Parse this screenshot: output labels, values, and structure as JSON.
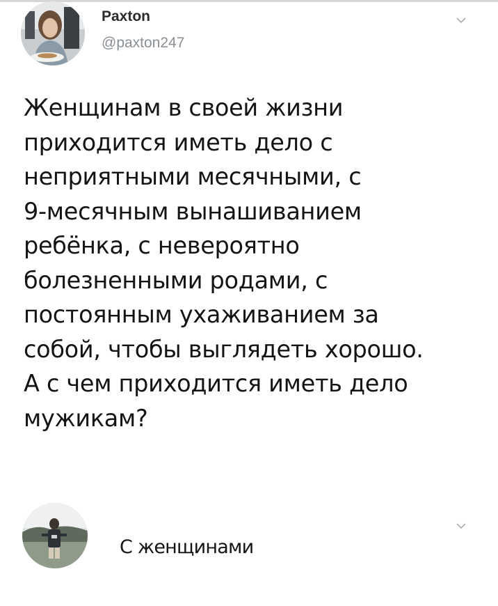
{
  "tweet_1": {
    "author_name": "Paxton",
    "author_handle": "@paxton247",
    "body": "Женщинам в своей жизни\nприходится иметь дело с\nнеприятными месячными, с\n9-месячным вынашиванием\nребёнка, с невероятно\nболезненными родами, с\nпостоянным ухаживанием за\nсобой, чтобы выглядеть хорошо.\nА с чем приходится иметь дело\nмужикам?",
    "avatar_icon": "profile-photo-woman",
    "menu_icon": "chevron-down-icon"
  },
  "tweet_2": {
    "body": "С женщинами",
    "avatar_icon": "profile-photo-man",
    "menu_icon": "chevron-down-icon"
  },
  "colors": {
    "text": "#141414",
    "handle": "#8a8f95",
    "background": "#ffffff"
  }
}
